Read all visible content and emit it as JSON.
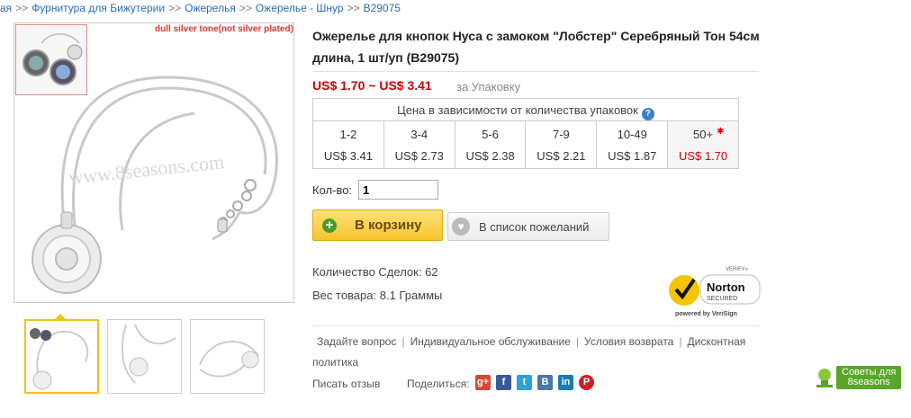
{
  "breadcrumb": {
    "items": [
      "ая",
      "Фурнитура для Бижутерии",
      "Ожерелья",
      "Ожерелье - Шнур",
      "B29075"
    ],
    "separator": ">>"
  },
  "product": {
    "image_tag": "dull silver tone(not silver plated)",
    "watermark": "www.8seasons.com",
    "title": "Ожерелье для кнопок Нуса с замоком \"Лобстер\" Серебряный Тон 54см длина, 1 шт/уп  (B29075)",
    "price_range": "US$ 1.70 ~ US$ 3.41",
    "price_unit": "за Упаковку"
  },
  "tiers": {
    "header": "Цена в зависимости от количества упаковок",
    "help_icon": "?",
    "columns": [
      {
        "qty": "1-2",
        "price": "US$ 3.41"
      },
      {
        "qty": "3-4",
        "price": "US$ 2.73"
      },
      {
        "qty": "5-6",
        "price": "US$ 2.38"
      },
      {
        "qty": "7-9",
        "price": "US$ 2.21"
      },
      {
        "qty": "10-49",
        "price": "US$ 1.87"
      },
      {
        "qty": "50+",
        "price": "US$ 1.70"
      }
    ]
  },
  "qty": {
    "label": "Кол-во:",
    "value": "1"
  },
  "buttons": {
    "cart": "В корзину",
    "wishlist": "В список пожеланий"
  },
  "info": {
    "deals": "Количество Сделок: 62",
    "weight": "Вес товара: 8.1 Граммы"
  },
  "norton": {
    "verify": "VERIFY»",
    "brand": "Norton",
    "secured": "SECURED",
    "powered": "powered by VeriSign"
  },
  "links": {
    "ask": "Задайте вопрос",
    "service": "Индивидуальное обслуживание",
    "returns": "Условия возврата",
    "discount": "Дисконтная политика"
  },
  "review": "Писать отзыв",
  "share": {
    "label": "Поделиться:",
    "networks": [
      {
        "name": "google-plus",
        "glyph": "g+",
        "color": "#d34836"
      },
      {
        "name": "facebook",
        "glyph": "f",
        "color": "#3b5998"
      },
      {
        "name": "twitter",
        "glyph": "t",
        "color": "#2fa1d9"
      },
      {
        "name": "vkontakte",
        "glyph": "B",
        "color": "#4a76a8"
      },
      {
        "name": "linkedin",
        "glyph": "in",
        "color": "#1a7ab3"
      },
      {
        "name": "pinterest",
        "glyph": "P",
        "color": "#cb2027"
      }
    ]
  },
  "tips": {
    "line1": "Советы для",
    "line2": "8seasons"
  }
}
